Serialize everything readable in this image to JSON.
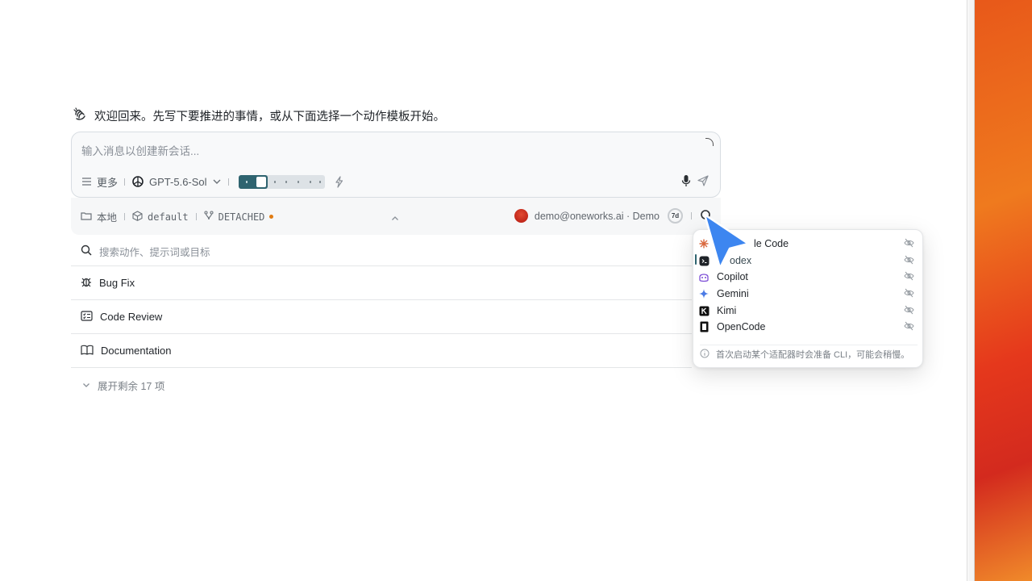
{
  "welcome": {
    "icon": "waving-hand-icon",
    "text": "欢迎回来。先写下要推进的事情，或从下面选择一个动作模板开始。"
  },
  "composer": {
    "placeholder": "输入消息以创建新会话...",
    "more_label": "更多",
    "model_label": "GPT-5.6-Sol",
    "reasoning_level": {
      "value": 2,
      "max": 7
    }
  },
  "status": {
    "location": "本地",
    "environment": "default",
    "branch": "DETACHED",
    "account": "demo@oneworks.ai · Demo",
    "badge": "7d"
  },
  "actions": {
    "search_placeholder": "搜索动作、提示词或目标",
    "items": [
      {
        "label": "Bug Fix",
        "icon": "bug-icon"
      },
      {
        "label": "Code Review",
        "icon": "checklist-icon"
      },
      {
        "label": "Documentation",
        "icon": "book-icon"
      }
    ],
    "expand_label": "展开剩余 17 项"
  },
  "adapter_menu": {
    "items": [
      {
        "label": "Claude Code",
        "visible_text": "le Code",
        "icon": "claude-icon"
      },
      {
        "label": "Codex",
        "visible_text": "odex",
        "icon": "codex-icon"
      },
      {
        "label": "Copilot",
        "visible_text": "Copilot",
        "icon": "copilot-icon"
      },
      {
        "label": "Gemini",
        "visible_text": "Gemini",
        "icon": "gemini-icon"
      },
      {
        "label": "Kimi",
        "visible_text": "Kimi",
        "icon": "kimi-icon"
      },
      {
        "label": "OpenCode",
        "visible_text": "OpenCode",
        "icon": "opencode-icon"
      }
    ],
    "note": "首次启动某个适配器时会准备 CLI，可能会稍慢。"
  },
  "colors": {
    "accent": "#2f6470",
    "branch_dot": "#e07b12",
    "cursor": "#3d86f0"
  }
}
